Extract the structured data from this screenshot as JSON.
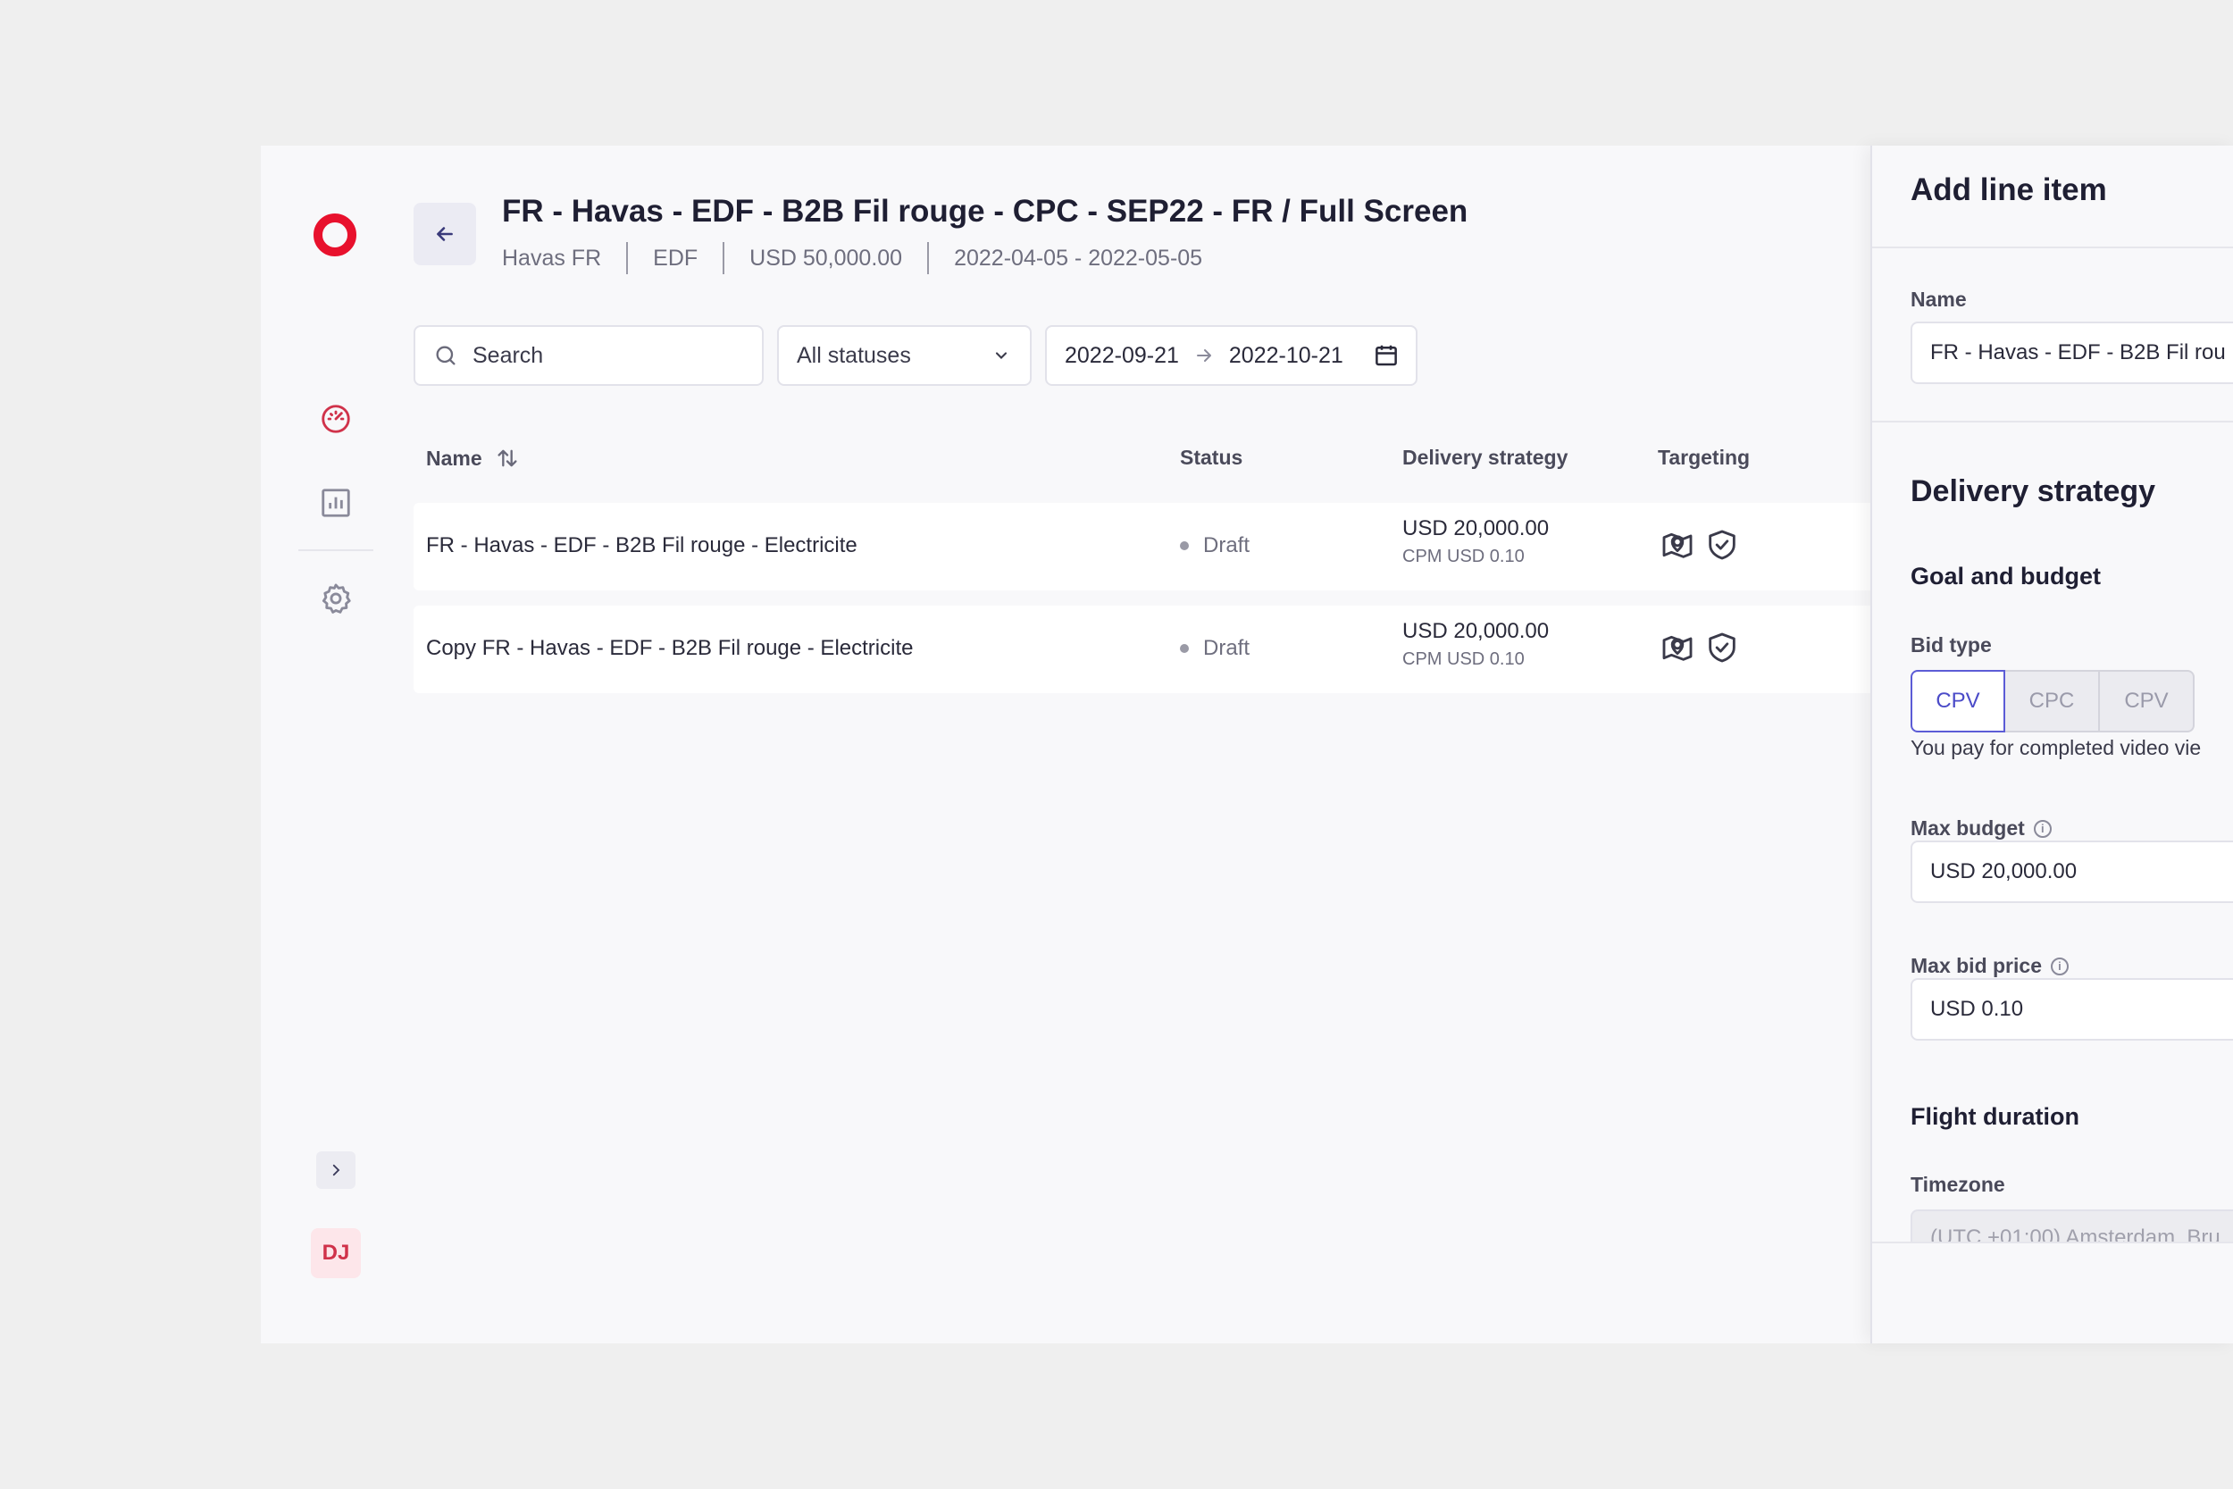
{
  "campaign": {
    "title": "FR - Havas - EDF - B2B Fil rouge - CPC - SEP22 - FR / Full Screen",
    "meta": [
      "Havas FR",
      "EDF",
      "USD 50,000.00",
      "2022-04-05 - 2022-05-05"
    ]
  },
  "sidebar": {
    "avatar_initials": "DJ"
  },
  "filters": {
    "search_placeholder": "Search",
    "status_value": "All statuses",
    "date_from": "2022-09-21",
    "date_to": "2022-10-21"
  },
  "table": {
    "columns": [
      "Name",
      "Status",
      "Delivery strategy",
      "Targeting"
    ],
    "rows": [
      {
        "name": "FR - Havas - EDF - B2B Fil rouge - Electricite",
        "status": "Draft",
        "budget": "USD 20,000.00",
        "bid": "CPM USD 0.10"
      },
      {
        "name": "Copy FR - Havas - EDF - B2B Fil rouge - Electricite",
        "status": "Draft",
        "budget": "USD 20,000.00",
        "bid": "CPM USD 0.10"
      }
    ]
  },
  "drawer": {
    "title": "Add line item",
    "name_label": "Name",
    "name_value": "FR - Havas - EDF - B2B Fil rou",
    "delivery_title": "Delivery strategy",
    "goal_title": "Goal and budget",
    "bid_type_label": "Bid type",
    "bid_types": [
      "CPV",
      "CPC",
      "CPV"
    ],
    "bid_type_selected": "CPV",
    "bid_help": "You pay for completed video vie",
    "max_budget_label": "Max budget",
    "max_budget_value": "USD 20,000.00",
    "max_bid_label": "Max bid price",
    "max_bid_value": "USD 0.10",
    "flight_title": "Flight duration",
    "timezone_label": "Timezone",
    "timezone_value": "(UTC +01:00) Amsterdam, Bru"
  },
  "colors": {
    "brand": "#e8112d",
    "accent": "#5c5cd6"
  }
}
